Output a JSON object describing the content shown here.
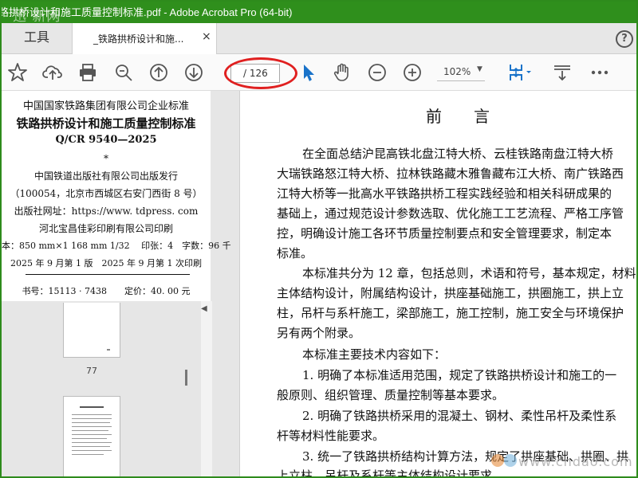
{
  "window": {
    "title": "路拱桥设计和施工质量控制标准.pdf - Adobe Acrobat Pro (64-bit)",
    "watermark_top": "迅 新网",
    "watermark_bottom": "www.chdao.com"
  },
  "tabs": {
    "tools": "工具",
    "document": "_铁路拱桥设计和施...",
    "close": "×",
    "help": "?"
  },
  "toolbar": {
    "page_current": "",
    "page_total": "/ 126",
    "zoom": "102%"
  },
  "cover": {
    "line1": "中国国家铁路集团有限公司企业标准",
    "line2": "铁路拱桥设计和施工质量控制标准",
    "line3": "Q/CR 9540—2025",
    "line4": "*",
    "line5": "中国铁道出版社有限公司出版发行",
    "line6": "（100054，北京市西城区右安门西街 8 号）",
    "line7": "出版社网址：https://www. tdpress. com",
    "line8": "河北宝昌佳彩印刷有限公司印刷",
    "line9": "本：850 mm×1 168 mm 1/32　 印张：4　字数：96 千",
    "line10": "2025 年 9 月第 1 版　2025 年 9 月第 1 次印刷",
    "line11": "书号：15113 · 7438　　定价：40. 00 元"
  },
  "thumbnails": {
    "page77": "77"
  },
  "document": {
    "heading": "前言",
    "lines": [
      "在全面总结沪昆高铁北盘江特大桥、云桂铁路南盘江特大桥",
      "大瑞铁路怒江特大桥、拉林铁路藏木雅鲁藏布江大桥、南广铁路西",
      "江特大桥等一批高水平铁路拱桥工程实践经验和相关科研成果的",
      "基础上，通过规范设计参数选取、优化施工工艺流程、严格工序管",
      "控，明确设计施工各环节质量控制要点和安全管理要求，制定本",
      "标准。",
      "本标准共分为 12 章，包括总则，术语和符号，基本规定，材料",
      "主体结构设计，附属结构设计，拱座基础施工，拱圈施工，拱上立",
      "柱，吊杆与系杆施工，梁部施工，施工控制，施工安全与环境保护",
      "另有两个附录。",
      "本标准主要技术内容如下：",
      "1. 明确了本标准适用范围，规定了铁路拱桥设计和施工的一",
      "般原则、组织管理、质量控制等基本要求。",
      "2. 明确了铁路拱桥采用的混凝土、钢材、柔性吊杆及柔性系",
      "杆等材料性能要求。",
      "3. 统一了铁路拱桥结构计算方法，规定了拱座基础、拱圈、拱",
      "上立柱、吊杆及系杆等主体结构设计要求。"
    ]
  },
  "colors": {
    "titlebar": "#2f8f1c",
    "accent_blue": "#1a73c9",
    "highlight_red": "#e02020"
  }
}
